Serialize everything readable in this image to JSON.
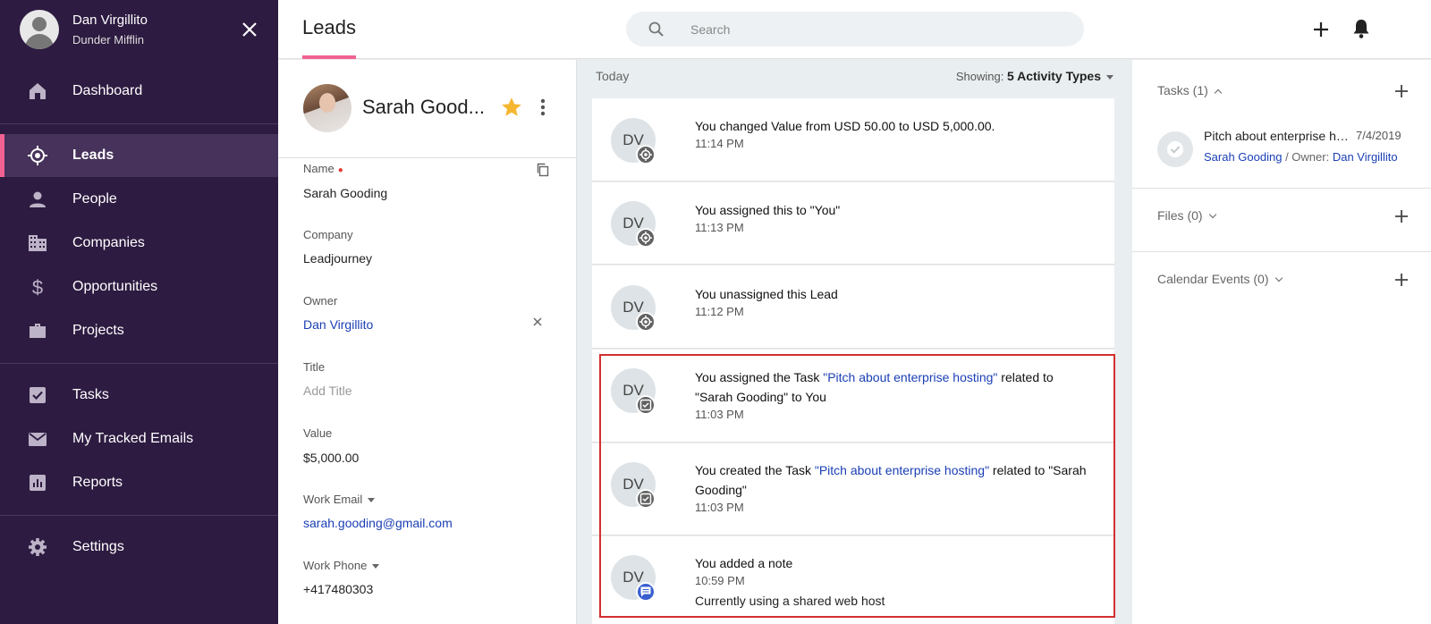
{
  "user": {
    "name": "Dan Virgillito",
    "org": "Dunder Mifflin"
  },
  "nav": {
    "dashboard": "Dashboard",
    "leads": "Leads",
    "people": "People",
    "companies": "Companies",
    "opportunities": "Opportunities",
    "projects": "Projects",
    "tasks": "Tasks",
    "emails": "My Tracked Emails",
    "reports": "Reports",
    "settings": "Settings"
  },
  "header": {
    "title": "Leads",
    "search_placeholder": "Search"
  },
  "lead": {
    "name": "Sarah Good...",
    "fields": {
      "name_label": "Name",
      "name_value": "Sarah Gooding",
      "company_label": "Company",
      "company_value": "Leadjourney",
      "owner_label": "Owner",
      "owner_value": "Dan Virgillito",
      "title_label": "Title",
      "title_placeholder": "Add Title",
      "value_label": "Value",
      "value_value": "$5,000.00",
      "email_label": "Work Email",
      "email_value": "sarah.gooding@gmail.com",
      "phone_label": "Work Phone",
      "phone_value": "+417480303"
    }
  },
  "feed": {
    "today": "Today",
    "showing_label": "Showing:",
    "showing_value": "5 Activity Types",
    "items": [
      {
        "initials": "DV",
        "text": "You changed Value from USD 50.00 to USD 5,000.00.",
        "time": "11:14 PM"
      },
      {
        "initials": "DV",
        "text": "You assigned this to \"You\"",
        "time": "11:13 PM"
      },
      {
        "initials": "DV",
        "text": "You unassigned this Lead",
        "time": "11:12 PM"
      },
      {
        "initials": "DV",
        "pre": "You assigned the Task ",
        "link": "\"Pitch about enterprise hosting\"",
        "post": " related to \"Sarah Gooding\" to You",
        "time": "11:03 PM"
      },
      {
        "initials": "DV",
        "pre": "You created the Task ",
        "link": "\"Pitch about enterprise hosting\"",
        "post": " related to \"Sarah Gooding\"",
        "time": "11:03 PM"
      },
      {
        "initials": "DV",
        "text": "You added a note",
        "time": "10:59 PM",
        "note": "Currently using a shared web host"
      }
    ]
  },
  "right": {
    "tasks_title": "Tasks (1)",
    "task": {
      "title": "Pitch about enterprise hosting",
      "date": "7/4/2019",
      "related": "Sarah Gooding",
      "owner_label": "/ Owner:",
      "owner": "Dan Virgillito"
    },
    "files_title": "Files (0)",
    "calendar_title": "Calendar Events (0)"
  },
  "colors": {
    "sidebar_bg": "#2d1b41",
    "accent": "#f06292",
    "link": "#1a3fb5",
    "highlight": "#d32f2f"
  }
}
